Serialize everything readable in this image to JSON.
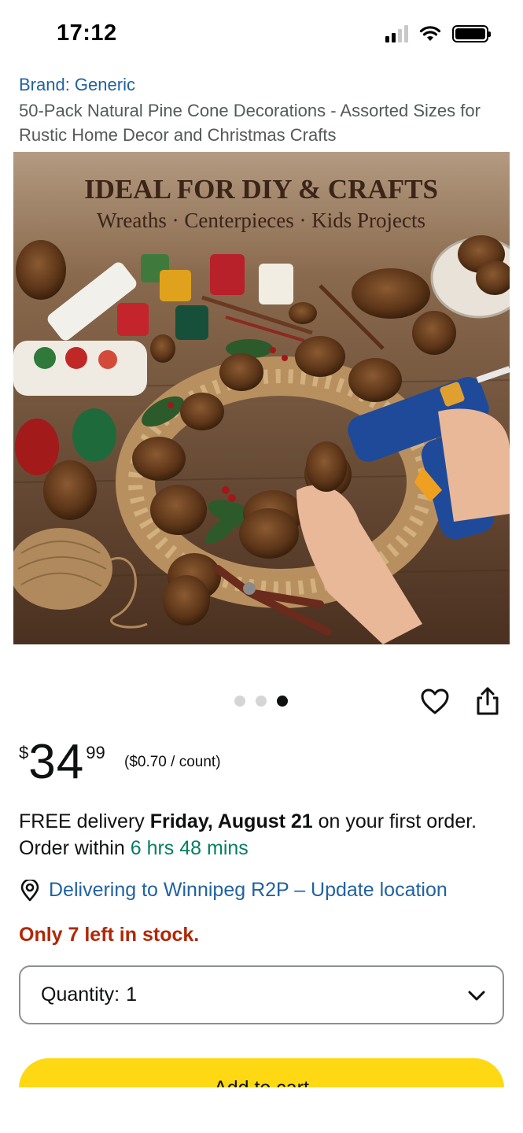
{
  "status_bar": {
    "time": "17:12",
    "icons": [
      "cellular-signal-icon",
      "wifi-icon",
      "battery-icon"
    ]
  },
  "product": {
    "brand": "Brand: Generic",
    "title": "50-Pack Natural Pine Cone Decorations - Assorted Sizes for Rustic Home Decor and Christmas Crafts",
    "image": {
      "headline": "IDEAL FOR DIY & CRAFTS",
      "subheadline": "Wreaths · Centerpieces · Kids Projects"
    }
  },
  "carousel": {
    "count": 3,
    "active_index": 2
  },
  "actions": {
    "wishlist_icon": "heart-icon",
    "share_icon": "share-icon"
  },
  "price": {
    "symbol": "$",
    "whole": "34",
    "fraction": "99",
    "unit_price": "($0.70 / count)"
  },
  "delivery": {
    "prefix": "FREE delivery ",
    "date": "Friday, August 21",
    "suffix": " on your first order. Order within ",
    "countdown": "6 hrs 48 mins"
  },
  "location": {
    "icon": "location-pin-icon",
    "text": "Delivering to Winnipeg R2P – Update location"
  },
  "stock": "Only 7 left in stock.",
  "quantity": {
    "label": "Quantity:",
    "value": "1",
    "icon": "chevron-down-icon"
  },
  "add_to_cart": "Add to cart",
  "colors": {
    "link": "#2162a1",
    "stock_warning": "#b12704",
    "countdown": "#067d62",
    "add_to_cart": "#ffd814"
  }
}
